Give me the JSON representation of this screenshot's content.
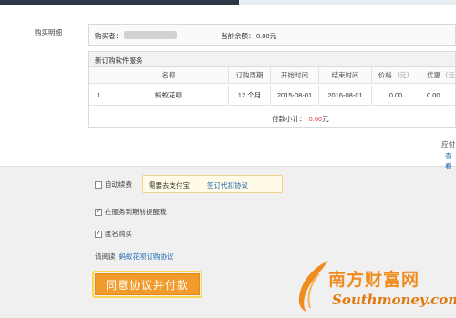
{
  "section": {
    "label": "购买明细"
  },
  "buyer": {
    "label": "购买者：",
    "balance_label": "当前余额：",
    "balance_value": "0.00元"
  },
  "order": {
    "title": "新订购软件服务",
    "columns": [
      {
        "label": "名称",
        "unit": ""
      },
      {
        "label": "订购周期",
        "unit": ""
      },
      {
        "label": "开始时间",
        "unit": ""
      },
      {
        "label": "结束时间",
        "unit": ""
      },
      {
        "label": "价格",
        "unit": "（元）"
      },
      {
        "label": "优惠",
        "unit": "（元"
      }
    ],
    "rows": [
      {
        "index": "1",
        "name": "蚂蚁花呗",
        "period": "12 个月",
        "start": "2015-08-01",
        "end": "2016-08-01",
        "price": "0.00",
        "discount": "0.00"
      }
    ],
    "subtotal_label": "付款小计：",
    "subtotal_value": "0.00",
    "subtotal_unit": "元"
  },
  "payment": {
    "label": "应付",
    "link": "查看"
  },
  "options": {
    "auto_renew": {
      "label": "自动续费",
      "checked": false
    },
    "auto_renew_tip": {
      "text": "需要去支付宝",
      "link": "签订代扣协议"
    },
    "remind": {
      "label": "在服务到期前提醒我",
      "checked": true
    },
    "anonymous": {
      "label": "匿名购买",
      "checked": true
    }
  },
  "agreement": {
    "prefix": "请阅读",
    "link": "蚂蚁花呗订购协议"
  },
  "submit": {
    "label": "同意协议并付款"
  },
  "watermark": {
    "cn": "南方财富网",
    "en": "Southmoney.com"
  },
  "colors": {
    "accent": "#f19b2c",
    "link": "#1a66b3",
    "amount": "#e4393c",
    "topbar": "#2d3745"
  }
}
